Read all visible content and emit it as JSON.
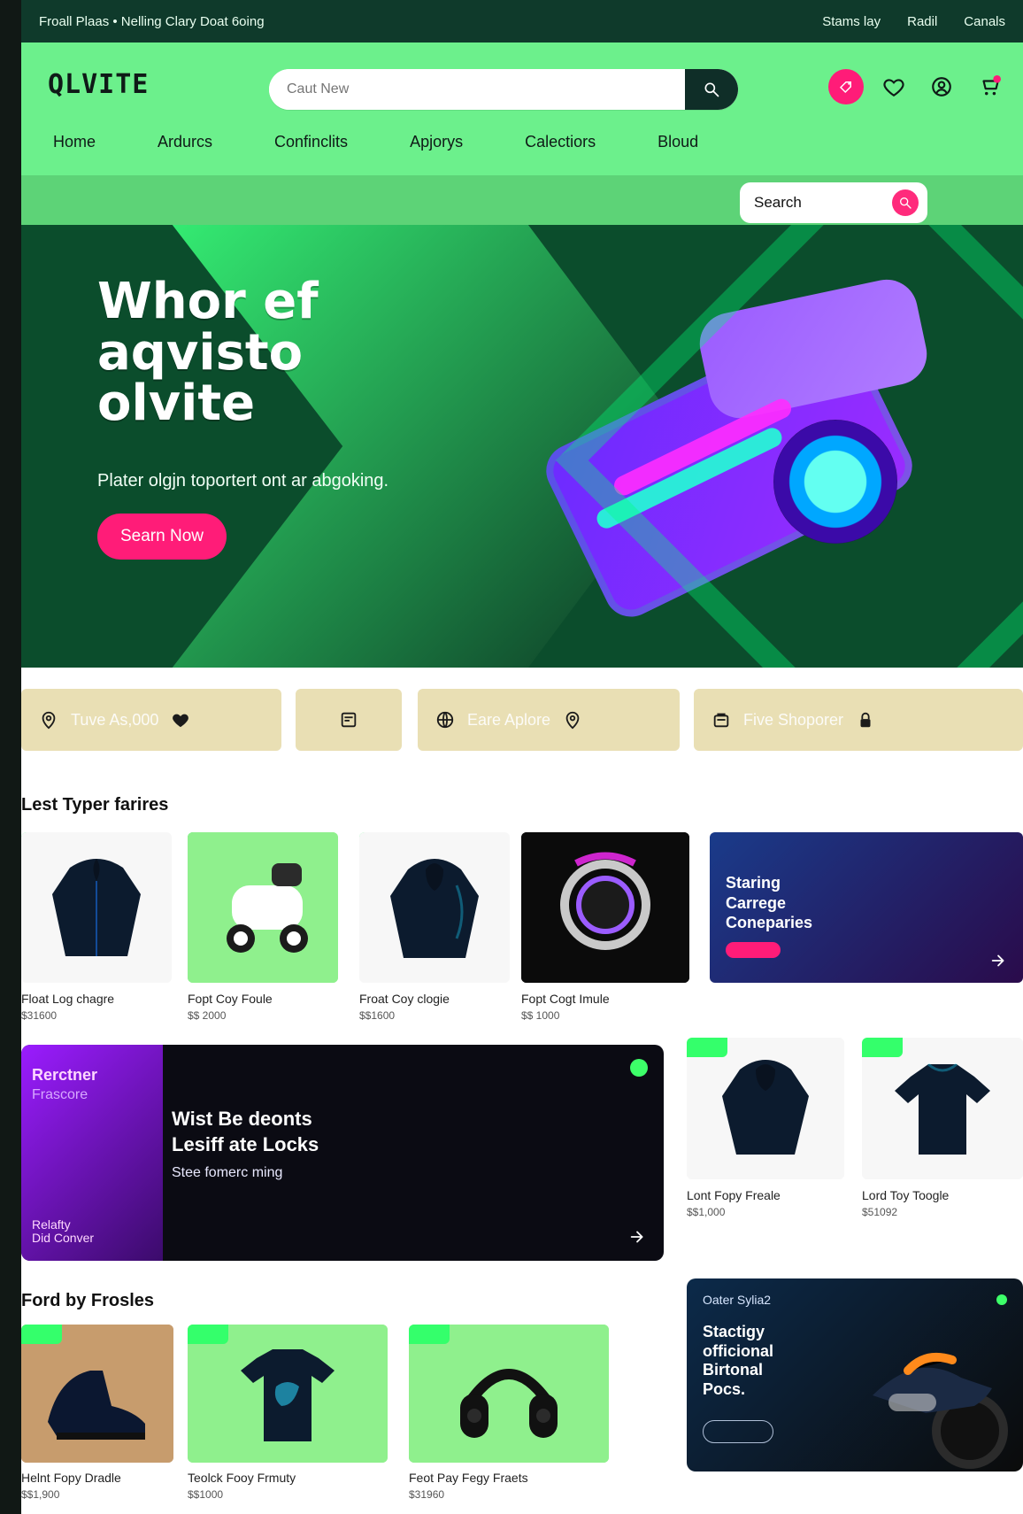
{
  "topbar": {
    "left": "Froall Plaas • Nelling Clary Doat 6oing",
    "links": [
      "Stams lay",
      "Radil",
      "Canals"
    ]
  },
  "header": {
    "logo": "QLVITE",
    "search_placeholder": "Caut New",
    "nav": [
      "Home",
      "Ardurcs",
      "Confinclits",
      "Apjorys",
      "Calectiors",
      "Bloud"
    ],
    "subsearch_placeholder": "Search"
  },
  "hero": {
    "title_line1": "Whor ef",
    "title_line2": "aqvisto",
    "title_line3": "olvite",
    "subtitle": "Plater olgjn toportert ont ar abgoking.",
    "cta": "Searn Now"
  },
  "pills": [
    {
      "text": "Tuve As,000"
    },
    {
      "text": ""
    },
    {
      "text": "Eare Aplore"
    },
    {
      "text": "Five Shoporer"
    }
  ],
  "sections": {
    "latest": "Lest Typer farires",
    "featured": "Ford by Frosles"
  },
  "latest": [
    {
      "title": "Float Log chagre",
      "price": "$31600"
    },
    {
      "title": "Fopt Coy Foule",
      "price": "$$ 2000"
    },
    {
      "title": "Froat Coy clogie",
      "price": "$$1600"
    },
    {
      "title": "Fopt Cogt Imule",
      "price": "$$ 1000"
    }
  ],
  "promo_card": {
    "title": "Staring\nCarrege\nConeparies"
  },
  "banner": {
    "left_title": "Rerctner",
    "left_sub": "Frascore",
    "left_small": "Relafty\nDid Conver",
    "main_title": "Wist Be deonts\nLesiff ate Locks",
    "main_sub": "Stee fomerc ming"
  },
  "mini": [
    {
      "title": "Lont Fopy Freale",
      "price": "$$1,000"
    },
    {
      "title": "Lord Toy Toogle",
      "price": "$51092"
    }
  ],
  "featured": [
    {
      "title": "Helnt Fopy Dradle",
      "price": "$$1,900"
    },
    {
      "title": "Teolck Fooy Frmuty",
      "price": "$$1000"
    },
    {
      "title": "Feot Pay Fegy Fraets",
      "price": "$31960"
    }
  ],
  "promo2": {
    "top": "Oater Sylia2",
    "title": "Stactigy\nofficional\nBirtonal\nPocs."
  }
}
